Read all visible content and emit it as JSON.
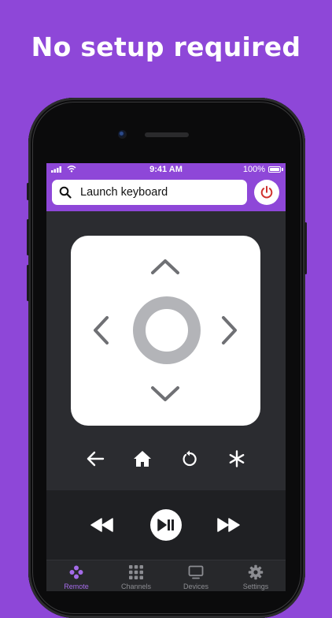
{
  "headline": "No setup required",
  "status_bar": {
    "time": "9:41 AM",
    "battery": "100%"
  },
  "search": {
    "label": "Launch keyboard",
    "icon": "search-icon"
  },
  "power": {
    "icon": "power-icon",
    "color": "#d0312d"
  },
  "dpad": {
    "up": "chevron-up-icon",
    "down": "chevron-down-icon",
    "left": "chevron-left-icon",
    "right": "chevron-right-icon",
    "ok": "ok-ring-icon"
  },
  "nav_buttons": [
    "back-arrow-icon",
    "home-icon",
    "replay-icon",
    "asterisk-icon"
  ],
  "media_buttons": [
    "rewind-icon",
    "play-pause-icon",
    "fast-forward-icon"
  ],
  "tabs": [
    {
      "label": "Remote",
      "icon": "gamepad-icon",
      "active": true
    },
    {
      "label": "Channels",
      "icon": "grid-icon",
      "active": false
    },
    {
      "label": "Devices",
      "icon": "tv-icon",
      "active": false
    },
    {
      "label": "Settings",
      "icon": "gear-icon",
      "active": false
    }
  ],
  "colors": {
    "background": "#8e47d8",
    "accent": "#a46be8",
    "remote_bg": "#2b2c30"
  }
}
